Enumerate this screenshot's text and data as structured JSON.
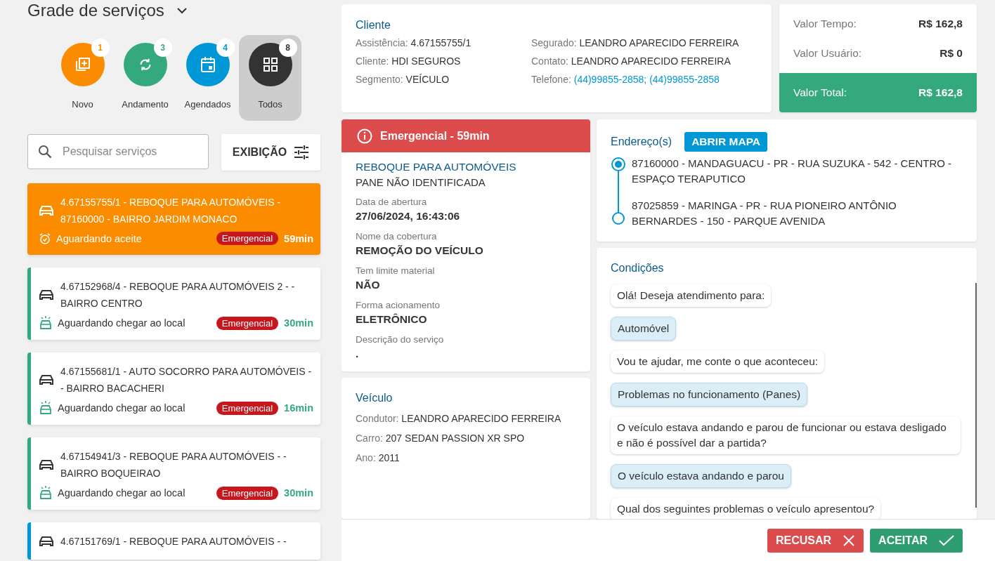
{
  "header": {
    "title": "Grade de serviços"
  },
  "categories": [
    {
      "label": "Novo",
      "count": "1",
      "kind": "new",
      "color": "#fb8c00",
      "selected": false
    },
    {
      "label": "Andamento",
      "count": "3",
      "kind": "progress",
      "color": "#35a97e",
      "selected": false
    },
    {
      "label": "Agendados",
      "count": "4",
      "kind": "scheduled",
      "color": "#0097d6",
      "selected": false
    },
    {
      "label": "Todos",
      "count": "8",
      "kind": "all",
      "color": "#333333",
      "selected": true
    }
  ],
  "search": {
    "placeholder": "Pesquisar serviços"
  },
  "view_button": {
    "label": "EXIBIÇÃO"
  },
  "services": [
    {
      "title": "4.67155755/1 - REBOQUE PARA AUTOMÓVEIS - 87160000 - BAIRRO JARDIM MONACO",
      "status": "Aguardando aceite",
      "kind": "alarm",
      "badge": "Emergencial",
      "time": "59min",
      "color": "#fb8c00",
      "selected": true
    },
    {
      "title": "4.67152968/4 - REBOQUE PARA AUTOMÓVEIS 2 - - BAIRRO CENTRO",
      "status": "Aguardando chegar ao local",
      "kind": "siren",
      "badge": "Emergencial",
      "time": "30min",
      "color": "#35a97e",
      "selected": false
    },
    {
      "title": "4.67155681/1 - AUTO SOCORRO PARA AUTOMÓVEIS - - BAIRRO BACACHERI",
      "status": "Aguardando chegar ao local",
      "kind": "siren",
      "badge": "Emergencial",
      "time": "16min",
      "color": "#35a97e",
      "selected": false
    },
    {
      "title": "4.67154941/3 - REBOQUE PARA AUTOMÓVEIS - - BAIRRO BOQUEIRAO",
      "status": "Aguardando chegar ao local",
      "kind": "siren",
      "badge": "Emergencial",
      "time": "30min",
      "color": "#35a97e",
      "selected": false
    },
    {
      "title": "4.67151769/1 - REBOQUE PARA AUTOMÓVEIS - -",
      "color": "#0097d6",
      "selected": false
    }
  ],
  "client": {
    "title": "Cliente",
    "fields": [
      {
        "label": "Assistência:",
        "value": "4.67155755/1"
      },
      {
        "label": "Segurado:",
        "value": "LEANDRO APARECIDO FERREIRA"
      },
      {
        "label": "Cliente:",
        "value": "HDI SEGUROS"
      },
      {
        "label": "Contato:",
        "value": "LEANDRO APARECIDO FERREIRA"
      },
      {
        "label": "Segmento:",
        "value": "VEÍCULO"
      },
      {
        "label": "Telefone:",
        "value": "(44)99855-2858; (44)99855-2858",
        "kind": "link"
      }
    ]
  },
  "values": [
    {
      "label": "Valor Tempo:",
      "value": "R$ 162,8",
      "kind": "normal"
    },
    {
      "label": "Valor Usuário:",
      "value": "R$ 0",
      "kind": "normal"
    },
    {
      "label": "Valor Total:",
      "value": "R$ 162,8",
      "kind": "total"
    }
  ],
  "service": {
    "alert": "Emergencial - 59min",
    "title": "REBOQUE PARA AUTOMÓVEIS",
    "subtitle": "PANE NÃO IDENTIFICADA",
    "fields": [
      {
        "label": "Data de abertura",
        "value": "27/06/2024, 16:43:06"
      },
      {
        "label": "Nome da cobertura",
        "value": "REMOÇÃO DO VEÍCULO"
      },
      {
        "label": "Tem limite material",
        "value": "NÃO"
      },
      {
        "label": "Forma acionamento",
        "value": "ELETRÔNICO"
      },
      {
        "label": "Descrição do serviço",
        "value": "."
      }
    ]
  },
  "vehicle": {
    "title": "Veículo",
    "fields": [
      {
        "label": "Condutor:",
        "value": "LEANDRO APARECIDO FERREIRA"
      },
      {
        "label": "Carro:",
        "value": "207 SEDAN PASSION XR SPO"
      },
      {
        "label": "Ano:",
        "value": "2011"
      }
    ]
  },
  "addresses": {
    "title": "Endereço(s)",
    "map_button": "ABRIR MAPA",
    "items": [
      {
        "text": "87160000 - MANDAGUACU - PR - RUA SUZUKA - 542 - CENTRO - ESPAÇO TERAPUTICO"
      },
      {
        "text": "87025859 - MARINGA - PR - RUA PIONEIRO ANTÔNIO BERNARDES - 150 - PARQUE AVENIDA"
      }
    ]
  },
  "conditions": {
    "title": "Condições",
    "messages": [
      {
        "text": "Olá! Deseja atendimento para:",
        "kind": "question"
      },
      {
        "text": "Automóvel",
        "kind": "answer"
      },
      {
        "text": "Vou te ajudar, me conte o que aconteceu:",
        "kind": "question"
      },
      {
        "text": "Problemas no funcionamento (Panes)",
        "kind": "answer"
      },
      {
        "text": "O veículo estava andando e parou de funcionar ou estava desligado e não é possível dar a partida?",
        "kind": "question"
      },
      {
        "text": "O veículo estava andando e parou",
        "kind": "answer"
      },
      {
        "text": "Qual dos seguintes problemas o veículo apresentou?",
        "kind": "question"
      }
    ]
  },
  "actions": [
    {
      "label": "RECUSAR",
      "kind": "reject"
    },
    {
      "label": "ACEITAR",
      "kind": "accept"
    }
  ]
}
